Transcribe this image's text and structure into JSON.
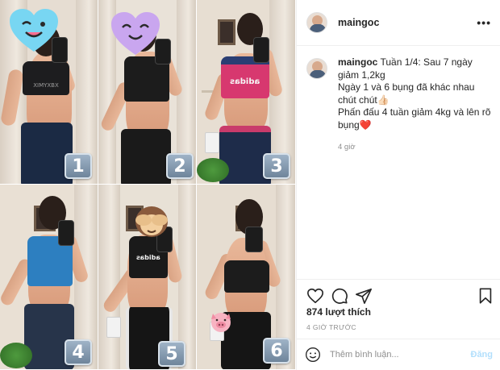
{
  "header": {
    "username": "maingoc",
    "more_label": "•••"
  },
  "caption": {
    "username": "maingoc",
    "lines": [
      "Tuần 1/4: Sau 7 ngày giảm 1,2kg",
      "Ngày 1 và 6 bụng đã khác nhau chút chút👍🏻",
      "Phấn đấu 4 tuần giảm 4kg và lên rõ bụng❤️"
    ],
    "time_ago": "4 giờ"
  },
  "media": {
    "photos": [
      {
        "number": "1",
        "bra_color": "#1d1d1f",
        "pants_color": "#1b2a44",
        "bra_text": "XIMYXBX"
      },
      {
        "number": "2",
        "bra_color": "#1c1c1c",
        "pants_color": "#1a1a1a",
        "bra_text": ""
      },
      {
        "number": "3",
        "bra_color": "#d7386f",
        "pants_color": "#1e2c4a",
        "bra_text": "adidas"
      },
      {
        "number": "4",
        "bra_color": "#2d7fc0",
        "pants_color": "#27344a",
        "bra_text": ""
      },
      {
        "number": "5",
        "bra_color": "#1a1a1a",
        "pants_color": "#151515",
        "bra_text": "adidas"
      },
      {
        "number": "6",
        "bra_color": "#1c1c1c",
        "pants_color": "#151515",
        "bra_text": ""
      }
    ],
    "stickers": [
      "wink-heart-emoji",
      "smiling-heart-emoji",
      "see-no-evil-monkey-emoji",
      "pig-face-emoji"
    ]
  },
  "actions": {
    "icons": [
      "heart-icon",
      "comment-icon",
      "share-icon",
      "bookmark-icon"
    ],
    "likes": "874 lượt thích",
    "posted": "4 GIỜ TRƯỚC"
  },
  "comment_box": {
    "placeholder": "Thêm bình luận...",
    "post_label": "Đăng"
  },
  "colors": {
    "link_disabled": "#b2dffc",
    "muted": "#8e8e8e",
    "text": "#262626",
    "border": "#efefef"
  }
}
